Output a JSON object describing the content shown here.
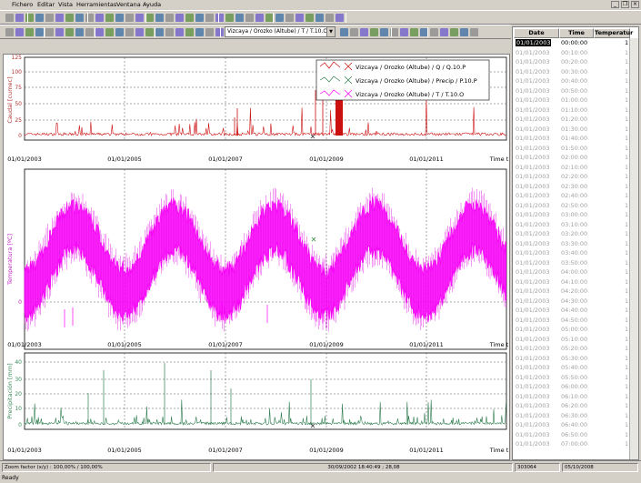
{
  "menu": [
    "Fichero",
    "Editar",
    "Vista",
    "Herramientas",
    "Ventana",
    "Ayuda"
  ],
  "toolbar": {
    "series_selected": "Vizcaya / Orozko (Altube) / T / T.10.O"
  },
  "colors": {
    "caudal": "#cc1010",
    "temperatura": "#ff00ff",
    "precip": "#2e7d4f",
    "axis_caudal": "#b03030",
    "axis_temp": "#c020c0",
    "axis_precip": "#3a8a5a"
  },
  "charts": {
    "caudal": {
      "ylabel": "Caudal [cumec]",
      "yticks": [
        "0",
        "25",
        "50",
        "75",
        "100",
        "125"
      ]
    },
    "temperatura": {
      "ylabel": "Temperatura [ºC]",
      "yticks": [
        "0"
      ]
    },
    "precip": {
      "ylabel": "Precipitación [mm]",
      "yticks": [
        "0",
        "10",
        "20",
        "30",
        "40"
      ]
    },
    "xticks": [
      "01/01/2003",
      "01/01/2005",
      "01/01/2007",
      "01/01/2009",
      "01/01/2011"
    ],
    "x_axis_label": "Time t",
    "legend": [
      "Vizcaya / Orozko (Altube) / Q / Q.10.P",
      "Vizcaya / Orozko (Altube) / Precip / P.10.P",
      "Vizcaya / Orozko (Altube) / T / T.10.O"
    ]
  },
  "table": {
    "headers": [
      "Date",
      "Time",
      "Temperatur"
    ],
    "rows": [
      [
        "01/01/2003",
        "00:00:00",
        "1"
      ],
      [
        "01/01/2003",
        "00:10:00",
        "1"
      ],
      [
        "01/01/2003",
        "00:20:00",
        "1"
      ],
      [
        "01/01/2003",
        "00:30:00",
        "1"
      ],
      [
        "01/01/2003",
        "00:40:00",
        "1"
      ],
      [
        "01/01/2003",
        "00:50:00",
        "1"
      ],
      [
        "01/01/2003",
        "01:00:00",
        "1"
      ],
      [
        "01/01/2003",
        "01:10:00",
        "1"
      ],
      [
        "01/01/2003",
        "01:20:00",
        "1"
      ],
      [
        "01/01/2003",
        "01:30:00",
        "1"
      ],
      [
        "01/01/2003",
        "01:40:00",
        "1"
      ],
      [
        "01/01/2003",
        "01:50:00",
        "1"
      ],
      [
        "01/01/2003",
        "02:00:00",
        "1"
      ],
      [
        "01/01/2003",
        "02:10:00",
        "1"
      ],
      [
        "01/01/2003",
        "02:20:00",
        "1"
      ],
      [
        "01/01/2003",
        "02:30:00",
        "1"
      ],
      [
        "01/01/2003",
        "02:40:00",
        "1"
      ],
      [
        "01/01/2003",
        "02:50:00",
        "1"
      ],
      [
        "01/01/2003",
        "03:00:00",
        "1"
      ],
      [
        "01/01/2003",
        "03:10:00",
        "1"
      ],
      [
        "01/01/2003",
        "03:20:00",
        "1"
      ],
      [
        "01/01/2003",
        "03:30:00",
        "1"
      ],
      [
        "01/01/2003",
        "03:40:00",
        "1"
      ],
      [
        "01/01/2003",
        "03:50:00",
        "1"
      ],
      [
        "01/01/2003",
        "04:00:00",
        "1"
      ],
      [
        "01/01/2003",
        "04:10:00",
        "1"
      ],
      [
        "01/01/2003",
        "04:20:00",
        "1"
      ],
      [
        "01/01/2003",
        "04:30:00",
        "1"
      ],
      [
        "01/01/2003",
        "04:40:00",
        "1"
      ],
      [
        "01/01/2003",
        "04:50:00",
        "1"
      ],
      [
        "01/01/2003",
        "05:00:00",
        "1"
      ],
      [
        "01/01/2003",
        "05:10:00",
        "1"
      ],
      [
        "01/01/2003",
        "05:20:00",
        "1"
      ],
      [
        "01/01/2003",
        "05:30:00",
        "1"
      ],
      [
        "01/01/2003",
        "05:40:00",
        "1"
      ],
      [
        "01/01/2003",
        "05:50:00",
        "1"
      ],
      [
        "01/01/2003",
        "06:00:00",
        "1"
      ],
      [
        "01/01/2003",
        "06:10:00",
        "1"
      ],
      [
        "01/01/2003",
        "06:20:00",
        "1"
      ],
      [
        "01/01/2003",
        "06:30:00",
        "1"
      ],
      [
        "01/01/2003",
        "06:40:00",
        "1"
      ],
      [
        "01/01/2003",
        "06:50:00",
        "1"
      ],
      [
        "01/01/2003",
        "07:00:00",
        "1"
      ]
    ]
  },
  "status": {
    "zoom": "Zoom factor (x/y) :  100,00% / 100,00%",
    "cursor": "30/09/2002 18:40:49 ; 28,08",
    "count": "303064",
    "date": "05/10/2008"
  },
  "ready": "Ready"
}
